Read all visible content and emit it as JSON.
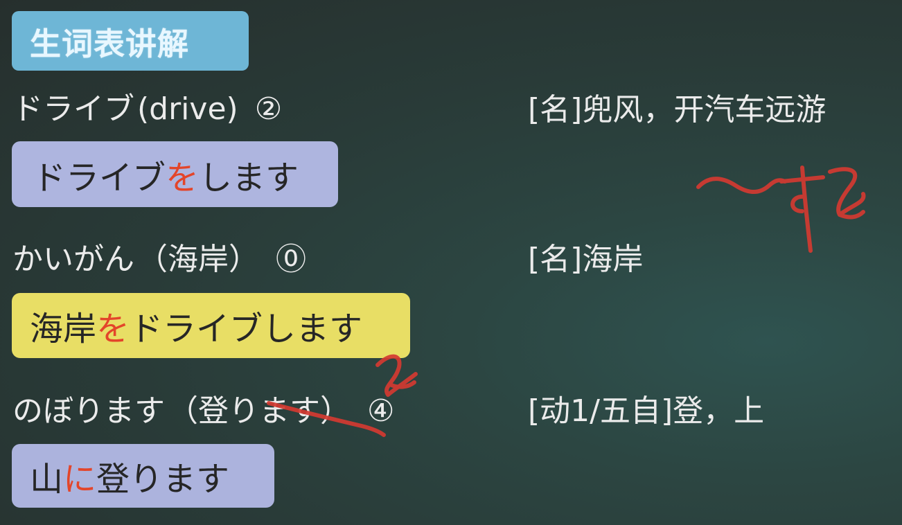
{
  "section_title": "生词表讲解",
  "vocab": [
    {
      "reading": "ドライブ",
      "origin": "(drive)",
      "pitch": "②",
      "definition": "[名]兜风，开汽车远游",
      "example": {
        "before": "ドライブ",
        "particle": "を",
        "after": "します"
      }
    },
    {
      "reading": "かいがん",
      "origin": "（海岸）",
      "pitch": "⓪",
      "definition": "[名]海岸",
      "example": {
        "before": "海岸",
        "particle": "を",
        "after": "ドライブします"
      }
    },
    {
      "reading": "のぼります",
      "origin": "（登ります）",
      "pitch": "④",
      "definition": "[动1/五自]登，上",
      "example": {
        "before": "山",
        "particle": "に",
        "after": "登ります"
      }
    }
  ],
  "colors": {
    "board": "#2c3f3c",
    "title_tab": "#6eb6d6",
    "pill_lavender": "#aeb5df",
    "pill_yellow": "#e8de65",
    "particle_red": "#e3452a",
    "ink_red": "#d43a31"
  }
}
